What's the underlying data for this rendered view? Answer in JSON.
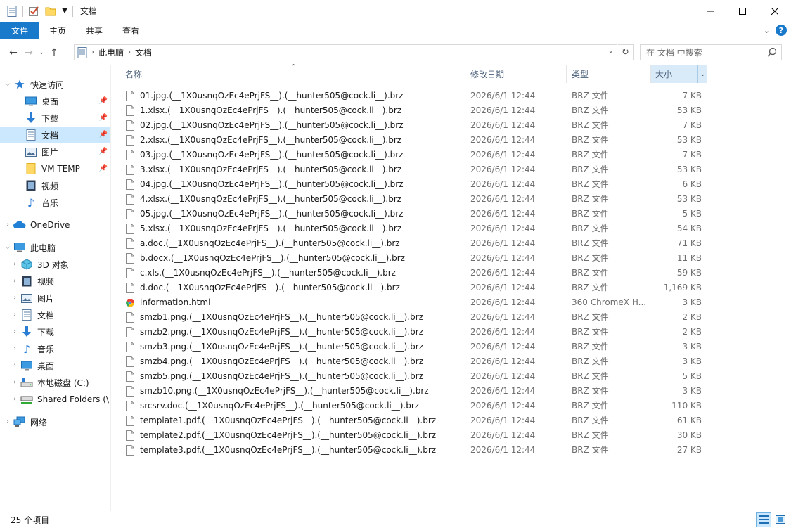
{
  "window": {
    "title": "文档",
    "minimize_icon": "minimize-icon",
    "maximize_icon": "maximize-icon",
    "close_icon": "close-icon"
  },
  "ribbon": {
    "tabs": [
      "文件",
      "主页",
      "共享",
      "查看"
    ],
    "help": "?"
  },
  "address": {
    "crumbs": [
      "此电脑",
      "文档"
    ]
  },
  "search": {
    "placeholder": "在 文档 中搜索"
  },
  "nav": {
    "items": [
      {
        "label": "快速访问",
        "icon": "star-icon"
      },
      {
        "label": "桌面",
        "icon": "desktop-icon"
      },
      {
        "label": "下载",
        "icon": "download-icon"
      },
      {
        "label": "文档",
        "icon": "document-icon"
      },
      {
        "label": "图片",
        "icon": "pictures-icon"
      },
      {
        "label": "VM TEMP",
        "icon": "folder-icon"
      },
      {
        "label": "视频",
        "icon": "video-icon"
      },
      {
        "label": "音乐",
        "icon": "music-icon"
      },
      {
        "label": "OneDrive",
        "icon": "cloud-icon"
      },
      {
        "label": "此电脑",
        "icon": "computer-icon"
      },
      {
        "label": "3D 对象",
        "icon": "3d-objects-icon"
      },
      {
        "label": "视频",
        "icon": "video-icon"
      },
      {
        "label": "图片",
        "icon": "pictures-icon"
      },
      {
        "label": "文档",
        "icon": "document-icon"
      },
      {
        "label": "下载",
        "icon": "download-icon"
      },
      {
        "label": "音乐",
        "icon": "music-icon"
      },
      {
        "label": "桌面",
        "icon": "desktop-icon"
      },
      {
        "label": "本地磁盘 (C:)",
        "icon": "drive-icon"
      },
      {
        "label": "Shared Folders (\\",
        "icon": "network-drive-icon"
      },
      {
        "label": "网络",
        "icon": "network-icon"
      }
    ]
  },
  "columns": {
    "name": "名称",
    "date": "修改日期",
    "type": "类型",
    "size": "大小"
  },
  "files": [
    {
      "name": "01.jpg.(__1X0usnqOzEc4ePrjFS__).(__hunter505@cock.li__).brz",
      "date": "2026/6/1 12:44",
      "type": "BRZ 文件",
      "size": "7 KB"
    },
    {
      "name": "1.xlsx.(__1X0usnqOzEc4ePrjFS__).(__hunter505@cock.li__).brz",
      "date": "2026/6/1 12:44",
      "type": "BRZ 文件",
      "size": "53 KB"
    },
    {
      "name": "02.jpg.(__1X0usnqOzEc4ePrjFS__).(__hunter505@cock.li__).brz",
      "date": "2026/6/1 12:44",
      "type": "BRZ 文件",
      "size": "7 KB"
    },
    {
      "name": "2.xlsx.(__1X0usnqOzEc4ePrjFS__).(__hunter505@cock.li__).brz",
      "date": "2026/6/1 12:44",
      "type": "BRZ 文件",
      "size": "53 KB"
    },
    {
      "name": "03.jpg.(__1X0usnqOzEc4ePrjFS__).(__hunter505@cock.li__).brz",
      "date": "2026/6/1 12:44",
      "type": "BRZ 文件",
      "size": "7 KB"
    },
    {
      "name": "3.xlsx.(__1X0usnqOzEc4ePrjFS__).(__hunter505@cock.li__).brz",
      "date": "2026/6/1 12:44",
      "type": "BRZ 文件",
      "size": "53 KB"
    },
    {
      "name": "04.jpg.(__1X0usnqOzEc4ePrjFS__).(__hunter505@cock.li__).brz",
      "date": "2026/6/1 12:44",
      "type": "BRZ 文件",
      "size": "6 KB"
    },
    {
      "name": "4.xlsx.(__1X0usnqOzEc4ePrjFS__).(__hunter505@cock.li__).brz",
      "date": "2026/6/1 12:44",
      "type": "BRZ 文件",
      "size": "53 KB"
    },
    {
      "name": "05.jpg.(__1X0usnqOzEc4ePrjFS__).(__hunter505@cock.li__).brz",
      "date": "2026/6/1 12:44",
      "type": "BRZ 文件",
      "size": "5 KB"
    },
    {
      "name": "5.xlsx.(__1X0usnqOzEc4ePrjFS__).(__hunter505@cock.li__).brz",
      "date": "2026/6/1 12:44",
      "type": "BRZ 文件",
      "size": "54 KB"
    },
    {
      "name": "a.doc.(__1X0usnqOzEc4ePrjFS__).(__hunter505@cock.li__).brz",
      "date": "2026/6/1 12:44",
      "type": "BRZ 文件",
      "size": "71 KB"
    },
    {
      "name": "b.docx.(__1X0usnqOzEc4ePrjFS__).(__hunter505@cock.li__).brz",
      "date": "2026/6/1 12:44",
      "type": "BRZ 文件",
      "size": "11 KB"
    },
    {
      "name": "c.xls.(__1X0usnqOzEc4ePrjFS__).(__hunter505@cock.li__).brz",
      "date": "2026/6/1 12:44",
      "type": "BRZ 文件",
      "size": "59 KB"
    },
    {
      "name": "d.doc.(__1X0usnqOzEc4ePrjFS__).(__hunter505@cock.li__).brz",
      "date": "2026/6/1 12:44",
      "type": "BRZ 文件",
      "size": "1,169 KB"
    },
    {
      "name": "information.html",
      "date": "2026/6/1 12:44",
      "type": "360 ChromeX H...",
      "size": "3 KB",
      "icon": "html-file-icon"
    },
    {
      "name": "smzb1.png.(__1X0usnqOzEc4ePrjFS__).(__hunter505@cock.li__).brz",
      "date": "2026/6/1 12:44",
      "type": "BRZ 文件",
      "size": "2 KB"
    },
    {
      "name": "smzb2.png.(__1X0usnqOzEc4ePrjFS__).(__hunter505@cock.li__).brz",
      "date": "2026/6/1 12:44",
      "type": "BRZ 文件",
      "size": "2 KB"
    },
    {
      "name": "smzb3.png.(__1X0usnqOzEc4ePrjFS__).(__hunter505@cock.li__).brz",
      "date": "2026/6/1 12:44",
      "type": "BRZ 文件",
      "size": "3 KB"
    },
    {
      "name": "smzb4.png.(__1X0usnqOzEc4ePrjFS__).(__hunter505@cock.li__).brz",
      "date": "2026/6/1 12:44",
      "type": "BRZ 文件",
      "size": "3 KB"
    },
    {
      "name": "smzb5.png.(__1X0usnqOzEc4ePrjFS__).(__hunter505@cock.li__).brz",
      "date": "2026/6/1 12:44",
      "type": "BRZ 文件",
      "size": "5 KB"
    },
    {
      "name": "smzb10.png.(__1X0usnqOzEc4ePrjFS__).(__hunter505@cock.li__).brz",
      "date": "2026/6/1 12:44",
      "type": "BRZ 文件",
      "size": "3 KB"
    },
    {
      "name": "srcsrv.doc.(__1X0usnqOzEc4ePrjFS__).(__hunter505@cock.li__).brz",
      "date": "2026/6/1 12:44",
      "type": "BRZ 文件",
      "size": "110 KB"
    },
    {
      "name": "template1.pdf.(__1X0usnqOzEc4ePrjFS__).(__hunter505@cock.li__).brz",
      "date": "2026/6/1 12:44",
      "type": "BRZ 文件",
      "size": "61 KB"
    },
    {
      "name": "template2.pdf.(__1X0usnqOzEc4ePrjFS__).(__hunter505@cock.li__).brz",
      "date": "2026/6/1 12:44",
      "type": "BRZ 文件",
      "size": "30 KB"
    },
    {
      "name": "template3.pdf.(__1X0usnqOzEc4ePrjFS__).(__hunter505@cock.li__).brz",
      "date": "2026/6/1 12:44",
      "type": "BRZ 文件",
      "size": "27 KB"
    }
  ],
  "status": {
    "count": "25 个项目"
  },
  "colors": {
    "accent": "#1979ca",
    "selection": "#cce8ff",
    "header_text": "#4c607a"
  }
}
